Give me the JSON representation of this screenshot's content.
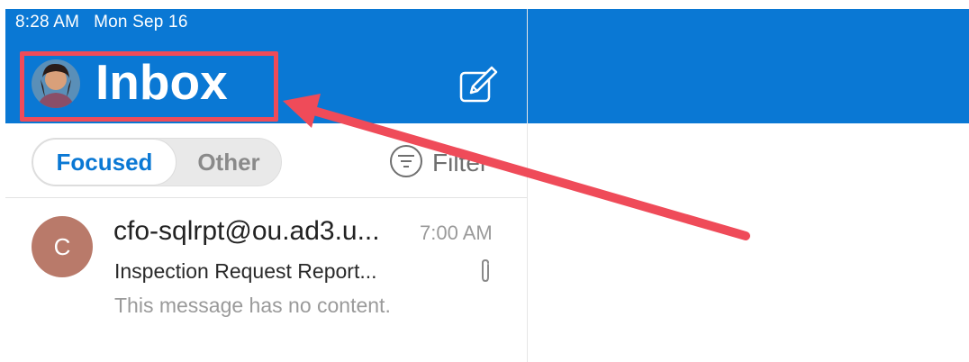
{
  "status_bar": {
    "time": "8:28 AM",
    "date": "Mon Sep 16"
  },
  "header": {
    "title": "Inbox",
    "compose_icon": "compose-icon",
    "avatar_icon": "user-avatar"
  },
  "tabs": {
    "focused_label": "Focused",
    "other_label": "Other",
    "filter_label": "Filter"
  },
  "messages": [
    {
      "initial": "C",
      "sender": "cfo-sqlrpt@ou.ad3.u...",
      "time": "7:00 AM",
      "subject": "Inspection Request Report...",
      "preview": "This message has no content.",
      "has_attachment": true
    }
  ],
  "colors": {
    "brand_blue": "#0a78d4",
    "annotation_red": "#ef4b59",
    "avatar_bg": "#b97a6a"
  }
}
